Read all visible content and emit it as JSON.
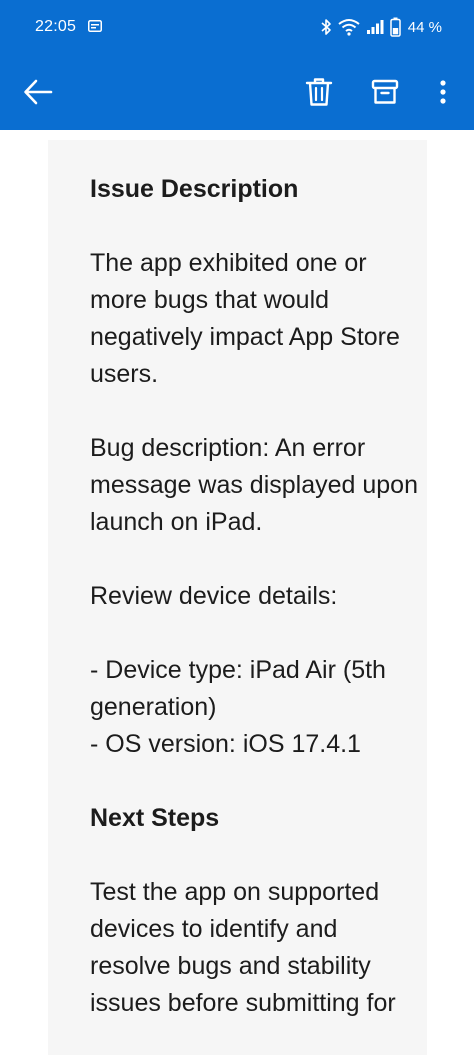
{
  "status_bar": {
    "time": "22:05",
    "battery": "44 %"
  },
  "app_bar": {
    "back_icon": "arrow-left-icon",
    "delete_icon": "trash-icon",
    "archive_icon": "archive-icon",
    "more_icon": "more-vertical-icon"
  },
  "colors": {
    "bar_bg": "#0a6ed1",
    "card_bg": "#f6f6f6",
    "text": "#1c1c1c"
  },
  "message": {
    "issue_heading": "Issue Description",
    "issue_text": "The app exhibited one or more bugs that would negatively impact App Store users.",
    "bug_description": "Bug description: An error message was displayed upon launch on iPad.",
    "review_details_label": "Review device details:",
    "device_type": "- Device type: iPad Air (5th generation)",
    "os_version": "- OS version: iOS 17.4.1",
    "next_heading": "Next Steps",
    "next_text": "Test the app on supported devices to identify and resolve bugs and stability issues before submitting for"
  }
}
